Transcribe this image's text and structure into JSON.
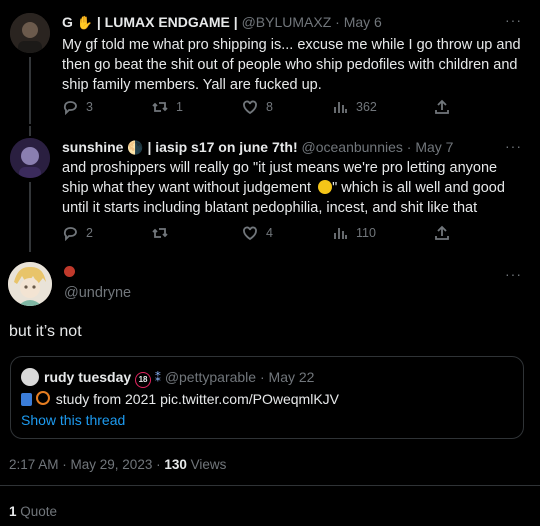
{
  "tweet1": {
    "display_name": "G",
    "display_name_rest": "| LUMAX ENDGAME |",
    "handle": "@BYLUMAXZ",
    "date": "· May 6",
    "text": "My gf told me what pro shipping is... excuse me while I go throw up and then go beat the shit out of people who ship pedofiles with children and ship family members. Yall are fucked up.",
    "replies": "3",
    "retweets": "1",
    "likes": "8",
    "views": "362"
  },
  "tweet2": {
    "display_name": "sunshine",
    "display_name_rest": "| iasip s17 on june 7th!",
    "handle": "@oceanbunnies",
    "date": "· May 7",
    "text_a": "and proshippers will really go \"it just means we're pro letting anyone ship what they want without judgement",
    "text_b": "\" which is all well and good until it starts including blatant pedophilia, incest, and shit like that",
    "replies": "2",
    "retweets": "",
    "likes": "4",
    "views": "110"
  },
  "main": {
    "handle": "@undryne",
    "text": "but it’s not",
    "quote": {
      "name": "rudy tuesday",
      "handle": "@pettyparable",
      "date": "· May 22",
      "text_prefix": "study from 2021",
      "link": "pic.twitter.com/POweqmlKJV",
      "show_thread": "Show this thread"
    },
    "time": "2:17 AM · May 29, 2023 ·",
    "view_count": "130",
    "views_label": "Views",
    "quote_count": "1",
    "quote_label": "Quote"
  },
  "more_label": "···",
  "colors": {
    "accent": "#1d9bf0",
    "muted": "#71767b",
    "border": "#2f3336",
    "background": "#000000"
  }
}
